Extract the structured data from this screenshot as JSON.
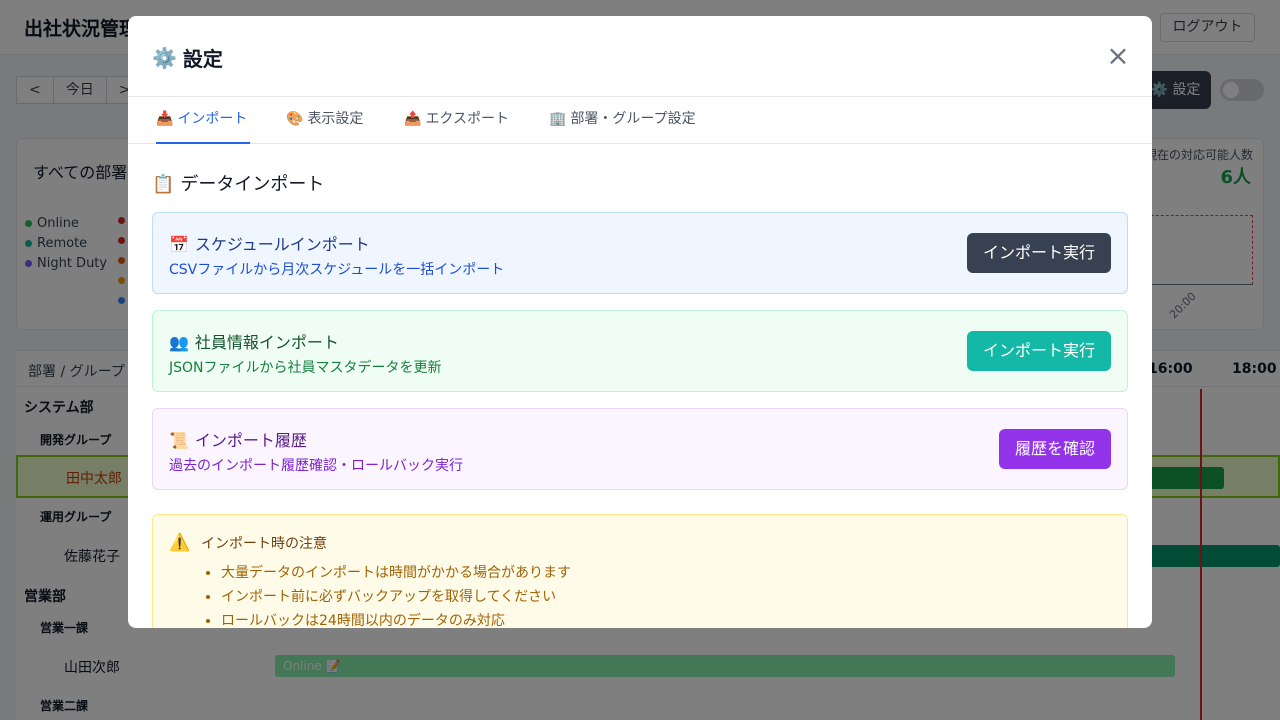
{
  "app": {
    "title": "出社状況管理",
    "logout": "ログアウト",
    "nav": {
      "prev": "<",
      "today": "今日",
      "next": ">"
    },
    "settings_button": "設定",
    "dept_select": "すべての部署",
    "legend": [
      "Online",
      "Remote",
      "Night Duty"
    ],
    "available_label": "現在の対応可能人数",
    "available_value": "6人",
    "mini_chart_tick": "20:00",
    "schedule": {
      "column_header": "部署 / グループ",
      "times": [
        "16:00",
        "18:00"
      ],
      "rows": [
        {
          "label": "システム部",
          "kind": "dept"
        },
        {
          "label": "開発グループ",
          "kind": "grp"
        },
        {
          "label": "田中太郎",
          "kind": "person"
        },
        {
          "label": "運用グループ",
          "kind": "grp"
        },
        {
          "label": "佐藤花子",
          "kind": "person"
        },
        {
          "label": "営業部",
          "kind": "dept"
        },
        {
          "label": "営業一課",
          "kind": "grp"
        },
        {
          "label": "山田次郎",
          "kind": "person"
        },
        {
          "label": "営業二課",
          "kind": "grp"
        }
      ],
      "online_bar_label": "Online 📝"
    }
  },
  "modal": {
    "title": "設定",
    "title_icon": "⚙️",
    "close": "×",
    "tabs": [
      {
        "icon": "📥",
        "label": "インポート"
      },
      {
        "icon": "🎨",
        "label": "表示設定"
      },
      {
        "icon": "📤",
        "label": "エクスポート"
      },
      {
        "icon": "🏢",
        "label": "部署・グループ設定"
      }
    ],
    "section_icon": "📋",
    "section_title": "データインポート",
    "cards": [
      {
        "icon": "📅",
        "title": "スケジュールインポート",
        "desc": "CSVファイルから月次スケジュールを一括インポート",
        "button": "インポート実行"
      },
      {
        "icon": "👥",
        "title": "社員情報インポート",
        "desc": "JSONファイルから社員マスタデータを更新",
        "button": "インポート実行"
      },
      {
        "icon": "📜",
        "title": "インポート履歴",
        "desc": "過去のインポート履歴確認・ロールバック実行",
        "button": "履歴を確認"
      }
    ],
    "warning": {
      "icon": "⚠️",
      "title": "インポート時の注意",
      "items": [
        "大量データのインポートは時間がかかる場合があります",
        "インポート前に必ずバックアップを取得してください",
        "ロールバックは24時間以内のデータのみ対応"
      ]
    }
  },
  "colors": {
    "accent": "#2563eb",
    "card1_button": "#374151",
    "card2_button": "#14b8a6",
    "card3_button": "#9333ea",
    "available": "#16a34a"
  }
}
